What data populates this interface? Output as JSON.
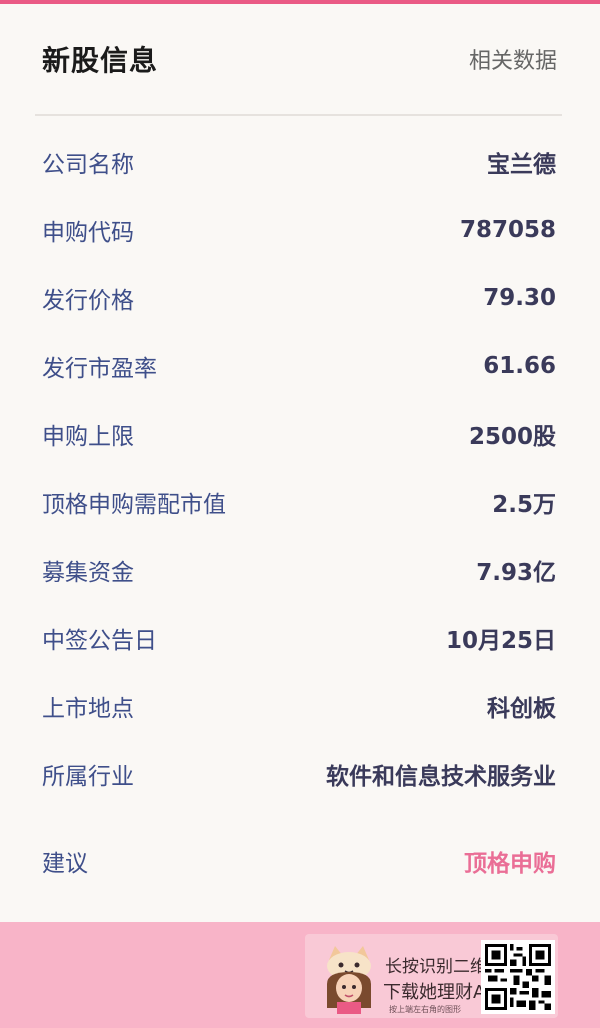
{
  "header": {
    "title": "新股信息",
    "related_link": "相关数据"
  },
  "rows": [
    {
      "label": "公司名称",
      "value": "宝兰德"
    },
    {
      "label": "申购代码",
      "value": "787058"
    },
    {
      "label": "发行价格",
      "value": "79.30"
    },
    {
      "label": "发行市盈率",
      "value": "61.66"
    },
    {
      "label": "申购上限",
      "value": "2500股"
    },
    {
      "label": "顶格申购需配市值",
      "value": "2.5万"
    },
    {
      "label": "募集资金",
      "value": "7.93亿"
    },
    {
      "label": "中签公告日",
      "value": "10月25日"
    },
    {
      "label": "上市地点",
      "value": "科创板"
    },
    {
      "label": "所属行业",
      "value": "软件和信息技术服务业"
    }
  ],
  "suggestion": {
    "label": "建议",
    "value": "顶格申购"
  },
  "promo": {
    "line1": "长按识别二维码",
    "line2": "下载她理财App",
    "line3": "按上端左右角的图形"
  },
  "colors": {
    "accent": "#ea5a85",
    "label": "#3f4f8a",
    "value": "#3a3a5a",
    "footer": "#f8b4c8"
  }
}
